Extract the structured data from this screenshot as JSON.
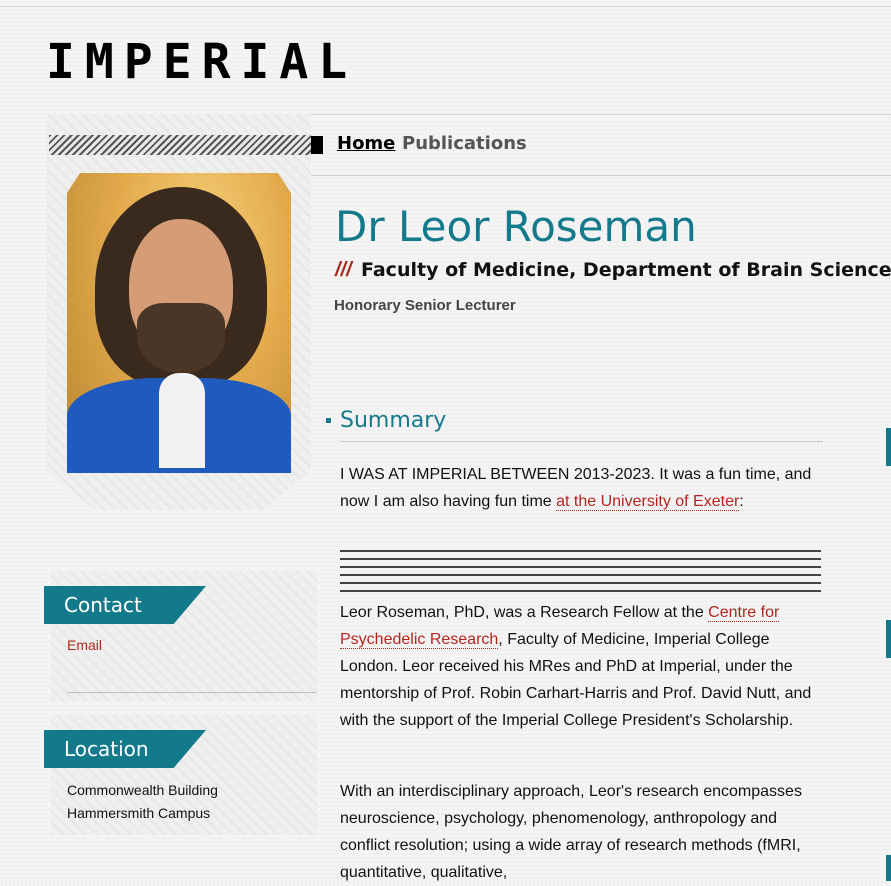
{
  "header": {
    "logo": "IMPERIAL"
  },
  "nav": {
    "items": [
      "Home",
      "Publications"
    ]
  },
  "profile": {
    "name": "Dr Leor Roseman",
    "slashes": "///",
    "faculty": "Faculty of Medicine, Department of Brain Sciences",
    "role": "Honorary Senior Lecturer"
  },
  "summary": {
    "title": "Summary",
    "p1_text": "I WAS AT IMPERIAL BETWEEN 2013-2023. It was a fun time, and now I am also having fun time ",
    "p1_link": "at the University of Exeter",
    "p1_end": ":",
    "p2_text": "Leor Roseman, PhD, was a Research Fellow at the ",
    "p2_link": "Centre for Psychedelic Research",
    "p2_end": ", Faculty of Medicine, Imperial College London. Leor received his MRes and PhD at Imperial, under the mentorship of Prof. Robin Carhart-Harris and Prof. David Nutt, and with the support of the Imperial College President's Scholarship.",
    "p3_text": "With an interdisciplinary approach, Leor's research encompasses neuroscience, psychology, phenomenology, anthropology and conflict resolution; using a wide array of research methods (fMRI, quantitative, qualitative,"
  },
  "contact": {
    "title": "Contact",
    "email_label": "Email"
  },
  "location": {
    "title": "Location",
    "line1": "Commonwealth Building",
    "line2": "Hammersmith Campus"
  },
  "colors": {
    "accent": "#137a8c",
    "link": "#b3261e",
    "slashes": "#a42a1e"
  }
}
